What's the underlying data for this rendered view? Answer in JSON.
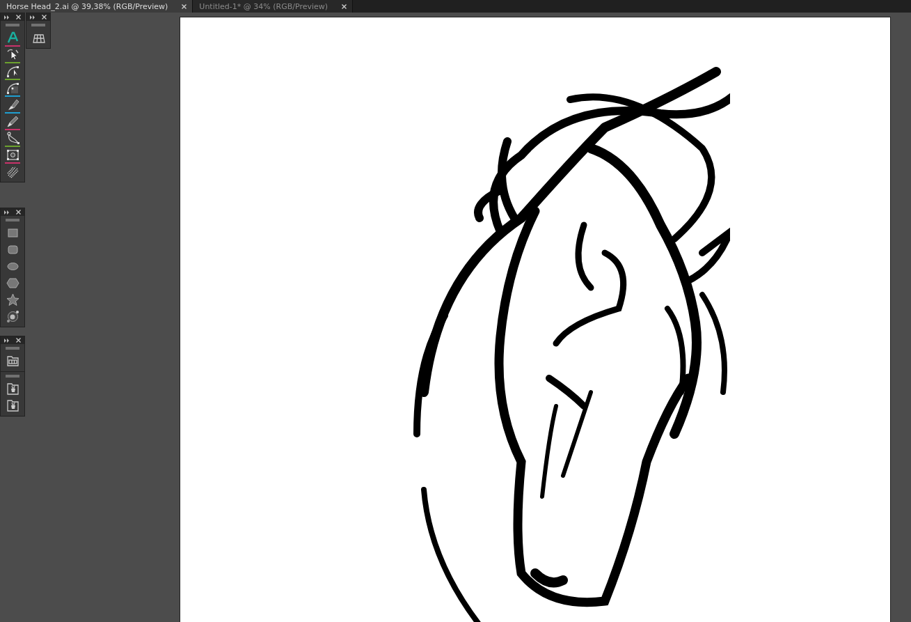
{
  "tabs": [
    {
      "label": "Horse Head_2.ai @ 39,38% (RGB/Preview)",
      "selected": true
    },
    {
      "label": "Untitled-1* @ 34% (RGB/Preview)",
      "selected": false
    }
  ],
  "panels": [
    {
      "sections": [
        {
          "tools": [
            {
              "kind": "type"
            },
            {
              "kind": "select",
              "color": "#c8336a"
            },
            {
              "kind": "curve-a",
              "color": "#6ca22e"
            },
            {
              "kind": "curve-b",
              "color": "#6ca22e"
            },
            {
              "kind": "brush",
              "color": "#1f9fd0"
            },
            {
              "kind": "pencil",
              "color": "#1f9fd0"
            },
            {
              "kind": "lasso",
              "color": "#c8336a"
            },
            {
              "kind": "transform",
              "color": "#6ca22e"
            },
            {
              "kind": "scatter",
              "color": "#c8336a"
            }
          ]
        }
      ]
    },
    {
      "sections": [
        {
          "tools": [
            {
              "kind": "mesh"
            }
          ]
        }
      ]
    },
    {
      "sections": [
        {
          "tools": [
            {
              "kind": "rect"
            },
            {
              "kind": "rounded"
            },
            {
              "kind": "ellipse"
            },
            {
              "kind": "polygon"
            },
            {
              "kind": "star"
            },
            {
              "kind": "flare"
            }
          ]
        }
      ]
    },
    {
      "sections": [
        {
          "tools": [
            {
              "kind": "frame"
            }
          ]
        },
        {
          "tools": [
            {
              "kind": "symbol"
            },
            {
              "kind": "symbol"
            }
          ]
        }
      ]
    }
  ]
}
